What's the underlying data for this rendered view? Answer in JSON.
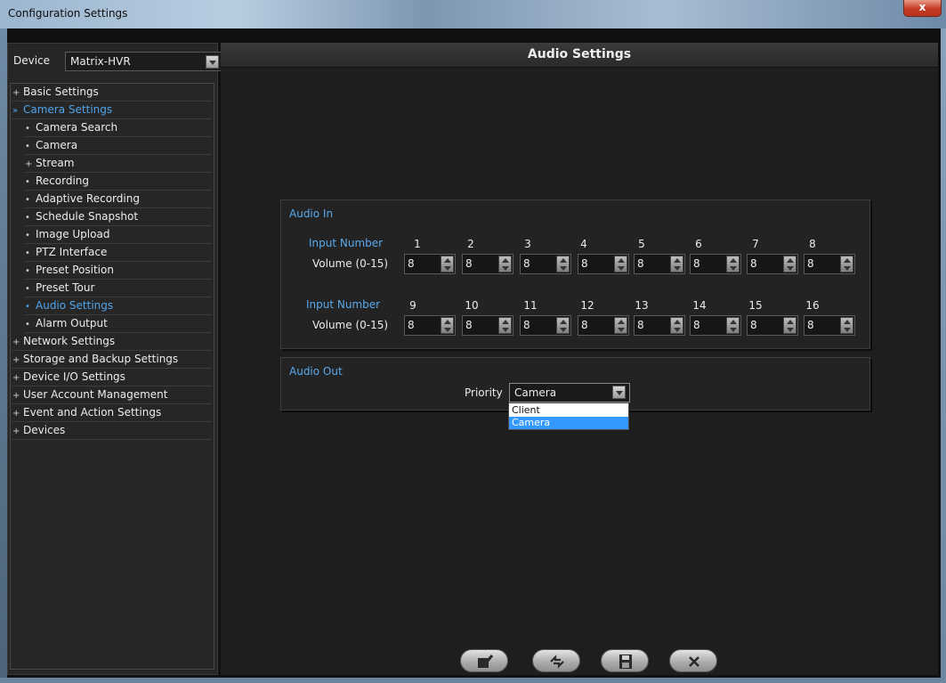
{
  "window": {
    "title": "Configuration Settings",
    "close_glyph": "x"
  },
  "device": {
    "label": "Device",
    "value": "Matrix-HVR"
  },
  "tree": [
    {
      "label": "Basic Settings",
      "marker": "+",
      "level": 0,
      "active": false
    },
    {
      "label": "Camera Settings",
      "marker": "»",
      "level": 0,
      "active": true
    },
    {
      "label": "Camera Search",
      "marker": "•",
      "level": 1,
      "active": false
    },
    {
      "label": "Camera",
      "marker": "•",
      "level": 1,
      "active": false
    },
    {
      "label": "Stream",
      "marker": "+",
      "level": 1,
      "active": false
    },
    {
      "label": "Recording",
      "marker": "•",
      "level": 1,
      "active": false
    },
    {
      "label": "Adaptive Recording",
      "marker": "•",
      "level": 1,
      "active": false
    },
    {
      "label": "Schedule Snapshot",
      "marker": "•",
      "level": 1,
      "active": false
    },
    {
      "label": "Image Upload",
      "marker": "•",
      "level": 1,
      "active": false
    },
    {
      "label": "PTZ Interface",
      "marker": "•",
      "level": 1,
      "active": false
    },
    {
      "label": "Preset Position",
      "marker": "•",
      "level": 1,
      "active": false
    },
    {
      "label": "Preset Tour",
      "marker": "•",
      "level": 1,
      "active": false
    },
    {
      "label": "Audio Settings",
      "marker": "•",
      "level": 1,
      "active": true
    },
    {
      "label": "Alarm Output",
      "marker": "•",
      "level": 1,
      "active": false
    },
    {
      "label": "Network Settings",
      "marker": "+",
      "level": 0,
      "active": false
    },
    {
      "label": "Storage and Backup Settings",
      "marker": "+",
      "level": 0,
      "active": false
    },
    {
      "label": "Device I/O Settings",
      "marker": "+",
      "level": 0,
      "active": false
    },
    {
      "label": "User Account Management",
      "marker": "+",
      "level": 0,
      "active": false
    },
    {
      "label": "Event and Action Settings",
      "marker": "+",
      "level": 0,
      "active": false
    },
    {
      "label": "Devices",
      "marker": "+",
      "level": 0,
      "active": false
    }
  ],
  "main": {
    "title": "Audio Settings",
    "audio_in": {
      "title": "Audio In",
      "input_number_label": "Input Number",
      "volume_label": "Volume (0-15)",
      "rows": [
        {
          "inputs": [
            "1",
            "2",
            "3",
            "4",
            "5",
            "6",
            "7",
            "8"
          ],
          "volumes": [
            "8",
            "8",
            "8",
            "8",
            "8",
            "8",
            "8",
            "8"
          ]
        },
        {
          "inputs": [
            "9",
            "10",
            "11",
            "12",
            "13",
            "14",
            "15",
            "16"
          ],
          "volumes": [
            "8",
            "8",
            "8",
            "8",
            "8",
            "8",
            "8",
            "8"
          ]
        }
      ]
    },
    "audio_out": {
      "title": "Audio Out",
      "priority_label": "Priority",
      "priority_value": "Camera",
      "options": [
        "Client",
        "Camera"
      ],
      "selected_option": "Camera"
    }
  },
  "toolbar": [
    {
      "name": "apply-button",
      "icon": "check-icon"
    },
    {
      "name": "refresh-button",
      "icon": "refresh-icon"
    },
    {
      "name": "save-button",
      "icon": "save-icon"
    },
    {
      "name": "cancel-button",
      "icon": "close-icon"
    }
  ],
  "colors": {
    "accent_blue": "#5aa9ec",
    "selection": "#3399ff",
    "background": "#1e1e1e"
  }
}
